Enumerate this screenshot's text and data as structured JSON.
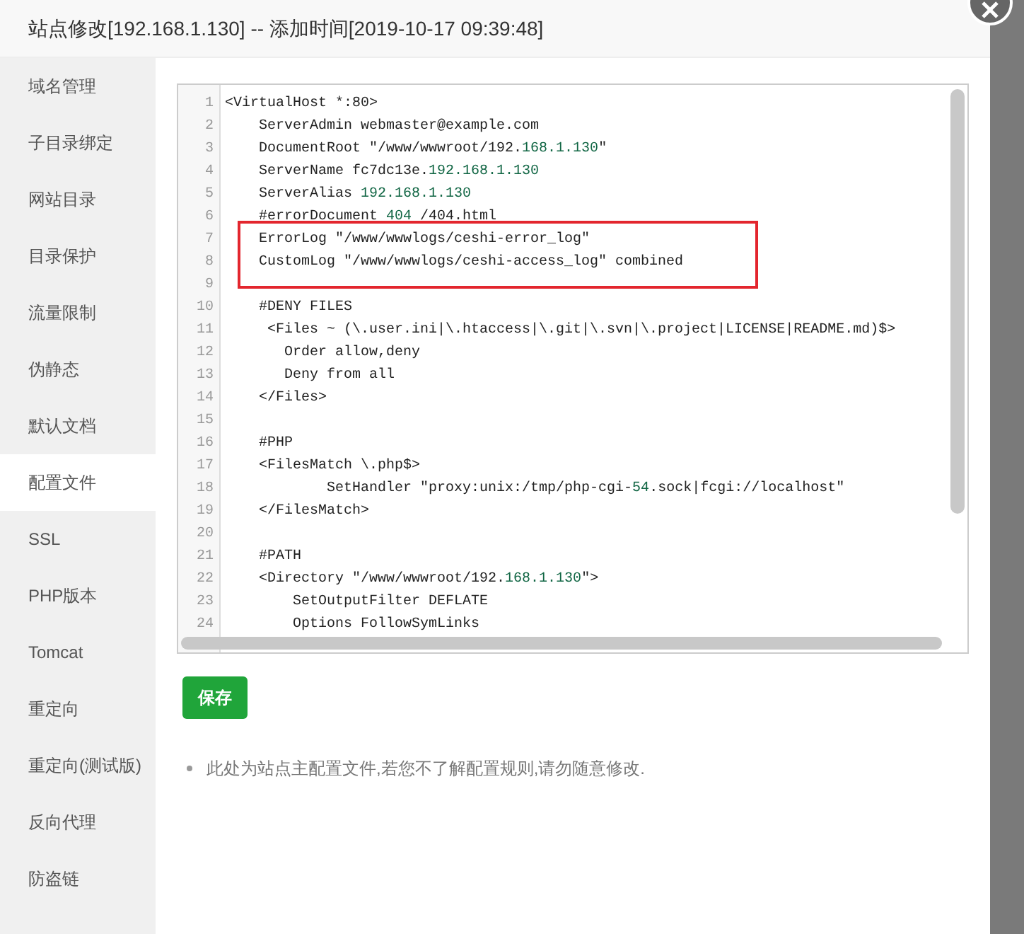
{
  "window": {
    "title": "站点修改[192.168.1.130] -- 添加时间[2019-10-17 09:39:48]"
  },
  "sidebar": {
    "items": [
      {
        "label": "域名管理",
        "selected": false
      },
      {
        "label": "子目录绑定",
        "selected": false
      },
      {
        "label": "网站目录",
        "selected": false
      },
      {
        "label": "目录保护",
        "selected": false
      },
      {
        "label": "流量限制",
        "selected": false
      },
      {
        "label": "伪静态",
        "selected": false
      },
      {
        "label": "默认文档",
        "selected": false
      },
      {
        "label": "配置文件",
        "selected": true
      },
      {
        "label": "SSL",
        "selected": false
      },
      {
        "label": "PHP版本",
        "selected": false
      },
      {
        "label": "Tomcat",
        "selected": false
      },
      {
        "label": "重定向",
        "selected": false
      },
      {
        "label": "重定向(测试版)",
        "selected": false
      },
      {
        "label": "反向代理",
        "selected": false
      },
      {
        "label": "防盗链",
        "selected": false
      }
    ]
  },
  "editor": {
    "lines": [
      {
        "number": "1",
        "segments": [
          {
            "text": "<VirtualHost *:80>",
            "kind": "plain"
          }
        ]
      },
      {
        "number": "2",
        "segments": [
          {
            "text": "    ServerAdmin webmaster@example.com",
            "kind": "plain"
          }
        ]
      },
      {
        "number": "3",
        "segments": [
          {
            "text": "    DocumentRoot \"/www/wwwroot/192.",
            "kind": "plain"
          },
          {
            "text": "168.1.130",
            "kind": "number"
          },
          {
            "text": "\"",
            "kind": "plain"
          }
        ]
      },
      {
        "number": "4",
        "segments": [
          {
            "text": "    ServerName fc7dc13e.",
            "kind": "plain"
          },
          {
            "text": "192.168.1.130",
            "kind": "number"
          }
        ]
      },
      {
        "number": "5",
        "segments": [
          {
            "text": "    ServerAlias ",
            "kind": "plain"
          },
          {
            "text": "192.168.1.130",
            "kind": "number"
          }
        ]
      },
      {
        "number": "6",
        "segments": [
          {
            "text": "    #errorDocument ",
            "kind": "plain"
          },
          {
            "text": "404",
            "kind": "number"
          },
          {
            "text": " /404.html",
            "kind": "plain"
          }
        ]
      },
      {
        "number": "7",
        "segments": [
          {
            "text": "    ErrorLog \"/www/wwwlogs/ceshi-error_log\"",
            "kind": "plain"
          }
        ]
      },
      {
        "number": "8",
        "segments": [
          {
            "text": "    CustomLog \"/www/wwwlogs/ceshi-access_log\" combined",
            "kind": "plain"
          }
        ]
      },
      {
        "number": "9"
      },
      {
        "number": "10",
        "segments": [
          {
            "text": "    #DENY FILES",
            "kind": "plain"
          }
        ]
      },
      {
        "number": "11",
        "segments": [
          {
            "text": "     <Files ~ (\\.user.ini|\\.htaccess|\\.git|\\.svn|\\.project|LICENSE|README.md)$>",
            "kind": "plain"
          }
        ]
      },
      {
        "number": "12",
        "segments": [
          {
            "text": "       Order allow,deny",
            "kind": "plain"
          }
        ]
      },
      {
        "number": "13",
        "segments": [
          {
            "text": "       Deny from all",
            "kind": "plain"
          }
        ]
      },
      {
        "number": "14",
        "segments": [
          {
            "text": "    </Files>",
            "kind": "plain"
          }
        ]
      },
      {
        "number": "15"
      },
      {
        "number": "16",
        "segments": [
          {
            "text": "    #PHP",
            "kind": "plain"
          }
        ]
      },
      {
        "number": "17",
        "segments": [
          {
            "text": "    <FilesMatch \\.php$>",
            "kind": "plain"
          }
        ]
      },
      {
        "number": "18",
        "segments": [
          {
            "text": "            SetHandler \"proxy:unix:/tmp/php-cgi-",
            "kind": "plain"
          },
          {
            "text": "54",
            "kind": "number"
          },
          {
            "text": ".sock|fcgi://localhost\"",
            "kind": "plain"
          }
        ]
      },
      {
        "number": "19",
        "segments": [
          {
            "text": "    </FilesMatch>",
            "kind": "plain"
          }
        ]
      },
      {
        "number": "20"
      },
      {
        "number": "21",
        "segments": [
          {
            "text": "    #PATH",
            "kind": "plain"
          }
        ]
      },
      {
        "number": "22",
        "segments": [
          {
            "text": "    <Directory \"/www/wwwroot/192.",
            "kind": "plain"
          },
          {
            "text": "168.1.130",
            "kind": "number"
          },
          {
            "text": "\">",
            "kind": "plain"
          }
        ]
      },
      {
        "number": "23",
        "segments": [
          {
            "text": "        SetOutputFilter DEFLATE",
            "kind": "plain"
          }
        ]
      },
      {
        "number": "24",
        "segments": [
          {
            "text": "        Options FollowSymLinks",
            "kind": "plain"
          }
        ]
      }
    ]
  },
  "save_button": "保存",
  "notes": [
    "此处为站点主配置文件,若您不了解配置规则,请勿随意修改."
  ]
}
